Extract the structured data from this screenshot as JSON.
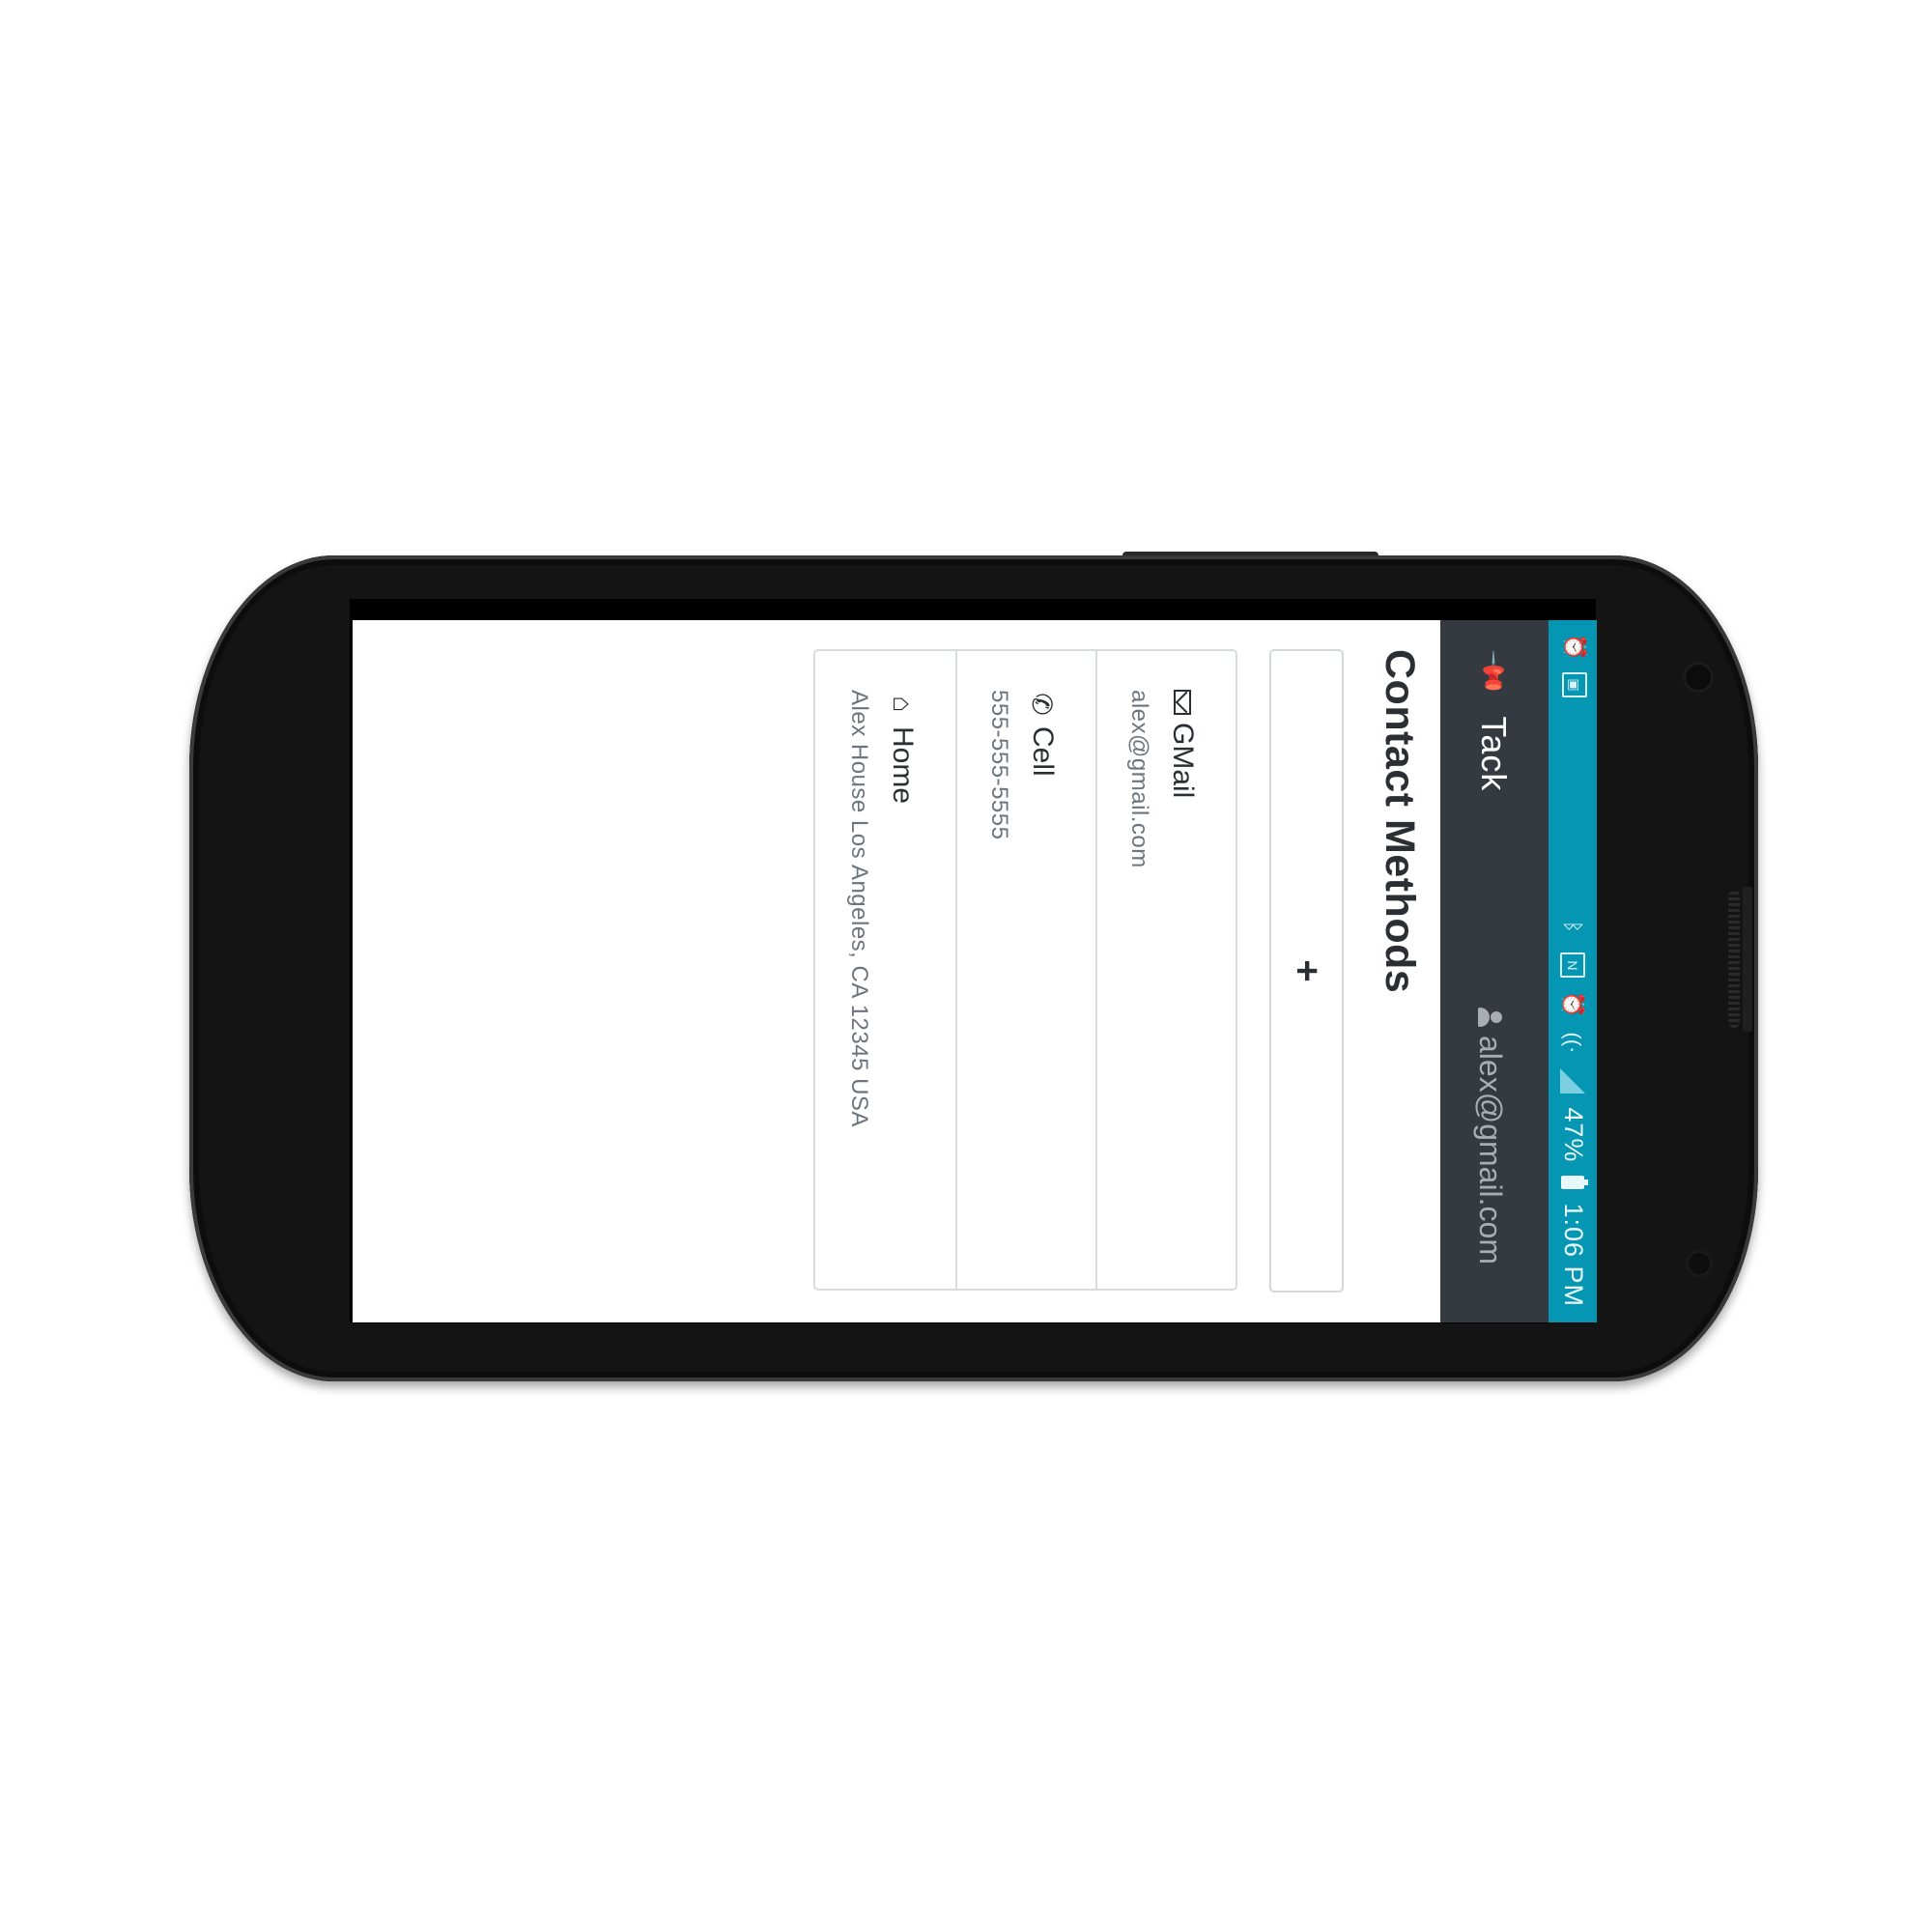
{
  "status_bar": {
    "left_icons": [
      "alarm-icon",
      "image-icon"
    ],
    "right_icons": [
      "bluetooth-icon",
      "nfc-icon",
      "alarm-clock-icon",
      "wifi-icon",
      "signal-icon"
    ],
    "battery": "47%",
    "time": "1:06 PM",
    "accent_color": "#0596b3"
  },
  "app_bar": {
    "brand": "Tack",
    "user_email": "alex@gmail.com",
    "background": "#343a40"
  },
  "page": {
    "title": "Contact Methods",
    "add_label": "+"
  },
  "contact_methods": [
    {
      "icon": "envelope-icon",
      "label": "GMail",
      "value": "alex@gmail.com"
    },
    {
      "icon": "phone-icon",
      "label": "Cell",
      "value": "555-555-5555"
    },
    {
      "icon": "home-icon",
      "label": "Home",
      "value": "Alex House Los Angeles, CA 12345 USA"
    }
  ]
}
